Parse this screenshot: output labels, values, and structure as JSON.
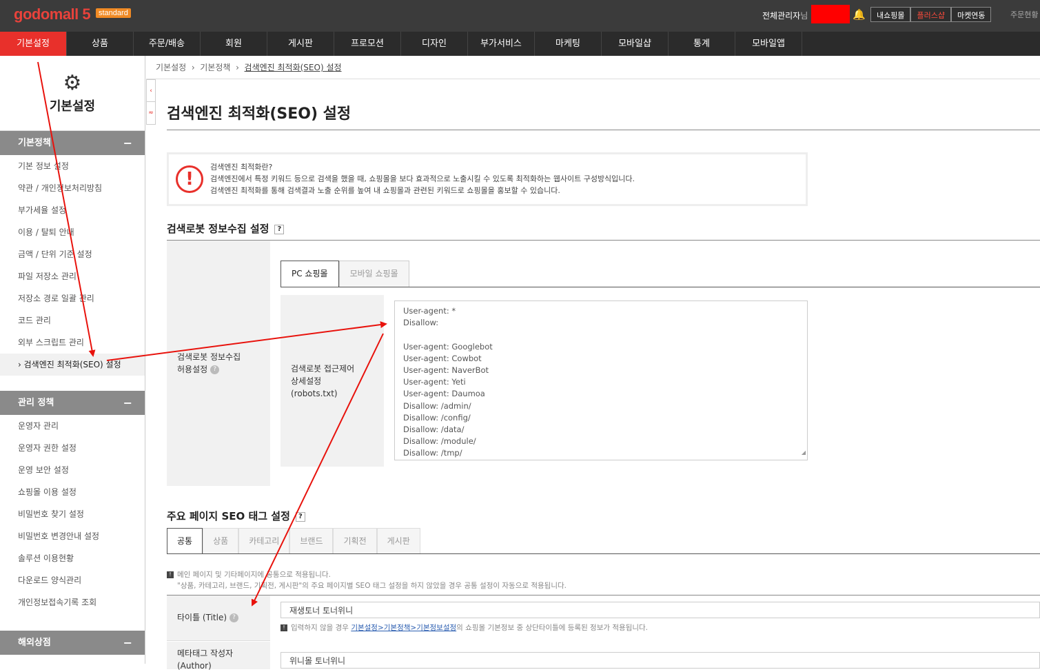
{
  "header": {
    "logo": "godomall 5",
    "logo_badge": "standard",
    "admin_name": "전체관리자",
    "admin_suffix": "님",
    "buttons": [
      "내쇼핑몰",
      "플러스샵",
      "마켓연동"
    ],
    "right_text": "주문현황"
  },
  "nav": [
    "기본설정",
    "상품",
    "주문/배송",
    "회원",
    "게시판",
    "프로모션",
    "디자인",
    "부가서비스",
    "마케팅",
    "모바일샵",
    "통계",
    "모바일앱"
  ],
  "sidebar": {
    "title": "기본설정",
    "sections": [
      {
        "title": "기본정책",
        "items": [
          "기본 정보 설정",
          "약관 / 개인정보처리방침",
          "부가세율 설정",
          "이용 / 탈퇴 안내",
          "금액 / 단위 기준 설정",
          "파일 저장소 관리",
          "저장소 경로 일괄 관리",
          "코드 관리",
          "외부 스크립트 관리",
          "검색엔진 최적화(SEO) 설정"
        ]
      },
      {
        "title": "관리 정책",
        "items": [
          "운영자 관리",
          "운영자 권한 설정",
          "운영 보안 설정",
          "쇼핑몰 이용 설정",
          "비밀번호 찾기 설정",
          "비밀번호 변경안내 설정",
          "솔루션 이용현황",
          "다운로드 양식관리",
          "개인정보접속기록 조회"
        ]
      },
      {
        "title": "해외상점",
        "items": []
      }
    ],
    "active_marker": "›"
  },
  "toggle": [
    "‹",
    "≈"
  ],
  "breadcrumb": [
    "기본설정",
    "기본정책",
    "검색엔진 최적화(SEO) 설정"
  ],
  "breadcrumb_sep": "›",
  "page_title": "검색엔진 최적화(SEO) 설정",
  "notice": {
    "icon": "!",
    "lines": [
      "검색엔진 최적화란?",
      "검색엔진에서 특정 키워드 등으로 검색을 했을 때, 쇼핑몰을 보다 효과적으로 노출시킬 수 있도록 최적화하는 웹사이트 구성방식입니다.",
      "검색엔진 최적화를 통해 검색결과 노출 순위를 높여 내 쇼핑몰과 관련된 키워드로 쇼핑몰을 홍보할 수 있습니다."
    ]
  },
  "robot_section": {
    "title": "검색로봇 정보수집 설정",
    "help": "?",
    "label_line1": "검색로봇 정보수집",
    "label_line2": "허용설정",
    "tabs": [
      "PC 쇼핑몰",
      "모바일 쇼핑몰"
    ],
    "inner_label": [
      "검색로봇 접근제어",
      "상세설정",
      "(robots.txt)"
    ],
    "robots_txt": "User-agent: *\nDisallow:\n\nUser-agent: Googlebot\nUser-agent: Cowbot\nUser-agent: NaverBot\nUser-agent: Yeti\nUser-agent: Daumoa\nDisallow: /admin/\nDisallow: /config/\nDisallow: /data/\nDisallow: /module/\nDisallow: /tmp/"
  },
  "seo_section": {
    "title": "주요 페이지 SEO 태그 설정",
    "help": "?",
    "tabs": [
      "공통",
      "상품",
      "카테고리",
      "브랜드",
      "기획전",
      "게시판"
    ],
    "info_icon": "!",
    "info1": "메인 페이지 및 기타페이지에 공통으로 적용됩니다.",
    "info2": "\"상품, 카테고리, 브랜드, 기획전, 게시판\"의 주요 페이지별 SEO 태그 설정을 하지 않았을 경우 공통 설정이 자동으로 적용됩니다.",
    "title_label": "타이틀 (Title)",
    "title_value": "재생토너 토너위니",
    "title_help_pre": "입력하지 않을 경우",
    "title_help_link": "기본설정>기본정책>기본정보설정",
    "title_help_post": "의 쇼핑몰 기본정보 중 상단타이틀에 등록된 정보가 적용됩니다.",
    "author_label": "메타태그 작성자",
    "author_label2": "(Author)",
    "author_value": "위니몰 토너위니"
  },
  "colors": {
    "accent": "#e8302b",
    "header_bg": "#3b3b3b",
    "nav_bg": "#2b2b2b",
    "section_bg": "#8a8a8a"
  }
}
